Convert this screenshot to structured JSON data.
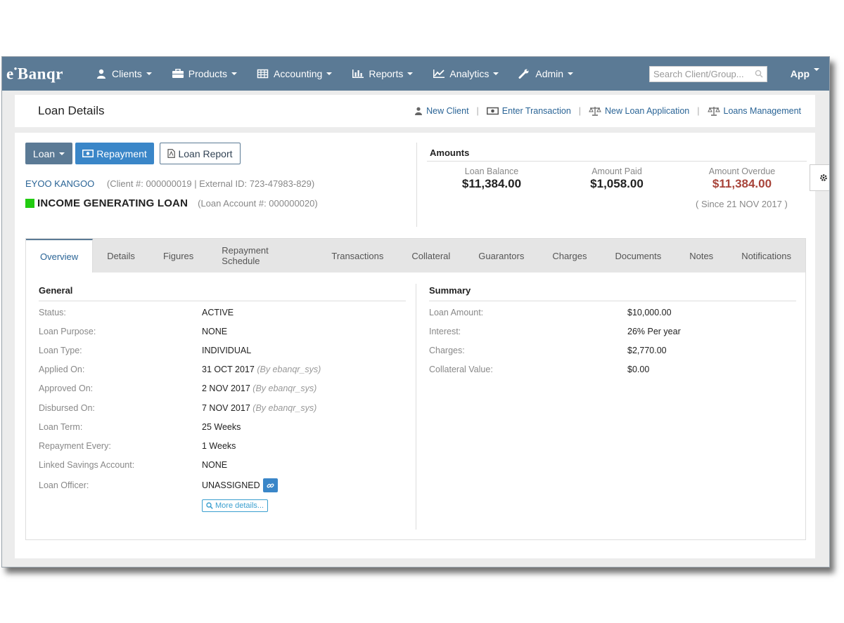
{
  "brand": {
    "prefix": "e",
    "mark": "•",
    "name": "Banqr"
  },
  "nav": {
    "items": [
      {
        "label": "Clients",
        "icon": "user-icon"
      },
      {
        "label": "Products",
        "icon": "briefcase-icon"
      },
      {
        "label": "Accounting",
        "icon": "table-icon"
      },
      {
        "label": "Reports",
        "icon": "bar-chart-icon"
      },
      {
        "label": "Analytics",
        "icon": "line-chart-icon"
      },
      {
        "label": "Admin",
        "icon": "wrench-icon"
      }
    ],
    "search_placeholder": "Search Client/Group...",
    "app_label": "App"
  },
  "header": {
    "title": "Loan Details",
    "actions": [
      {
        "label": "New Client",
        "icon": "user-icon"
      },
      {
        "label": "Enter Transaction",
        "icon": "money-icon"
      },
      {
        "label": "New Loan Application",
        "icon": "balance-scale-icon"
      },
      {
        "label": "Loans Management",
        "icon": "balance-scale-icon"
      }
    ],
    "separator": "|"
  },
  "buttons": {
    "loan": "Loan",
    "repayment": "Repayment",
    "loan_report": "Loan Report"
  },
  "client": {
    "name": "EYOO KANGOO",
    "meta": "(Client #: 000000019 | External ID: 723-47983-829)",
    "loan_name": "INCOME GENERATING LOAN",
    "loan_meta": "(Loan Account #: 000000020)",
    "status_color": "#22cc11"
  },
  "amounts": {
    "title": "Amounts",
    "items": [
      {
        "label": "Loan Balance",
        "value": "$11,384.00"
      },
      {
        "label": "Amount Paid",
        "value": "$1,058.00"
      },
      {
        "label": "Amount Overdue",
        "value": "$11,384.00"
      }
    ],
    "since": "( Since 21 NOV 2017 )"
  },
  "tabs": [
    "Overview",
    "Details",
    "Figures",
    "Repayment Schedule",
    "Transactions",
    "Collateral",
    "Guarantors",
    "Charges",
    "Documents",
    "Notes",
    "Notifications"
  ],
  "general": {
    "title": "General",
    "rows": [
      {
        "key": "Status:",
        "value": "ACTIVE",
        "by": ""
      },
      {
        "key": "Loan Purpose:",
        "value": "NONE",
        "by": ""
      },
      {
        "key": "Loan Type:",
        "value": "INDIVIDUAL",
        "by": ""
      },
      {
        "key": "Applied On:",
        "value": "31 OCT 2017",
        "by": "(By ebanqr_sys)"
      },
      {
        "key": "Approved On:",
        "value": "2 NOV 2017",
        "by": "(By ebanqr_sys)"
      },
      {
        "key": "Disbursed On:",
        "value": "7 NOV 2017",
        "by": "(By ebanqr_sys)"
      },
      {
        "key": "Loan Term:",
        "value": "25 Weeks",
        "by": ""
      },
      {
        "key": "Repayment Every:",
        "value": "1 Weeks",
        "by": ""
      },
      {
        "key": "Linked Savings Account:",
        "value": "NONE",
        "by": ""
      },
      {
        "key": "Loan Officer:",
        "value": "UNASSIGNED",
        "by": ""
      }
    ],
    "more_details": "More details..."
  },
  "summary": {
    "title": "Summary",
    "rows": [
      {
        "key": "Loan Amount:",
        "value": "$10,000.00"
      },
      {
        "key": "Interest:",
        "value": "26% Per year"
      },
      {
        "key": "Charges:",
        "value": "$2,770.00"
      },
      {
        "key": "Collateral Value:",
        "value": "$0.00"
      }
    ]
  },
  "colors": {
    "navbar": "#5b7a95",
    "primary": "#3a86c8",
    "link": "#2a6496",
    "overdue": "#a8443a"
  }
}
